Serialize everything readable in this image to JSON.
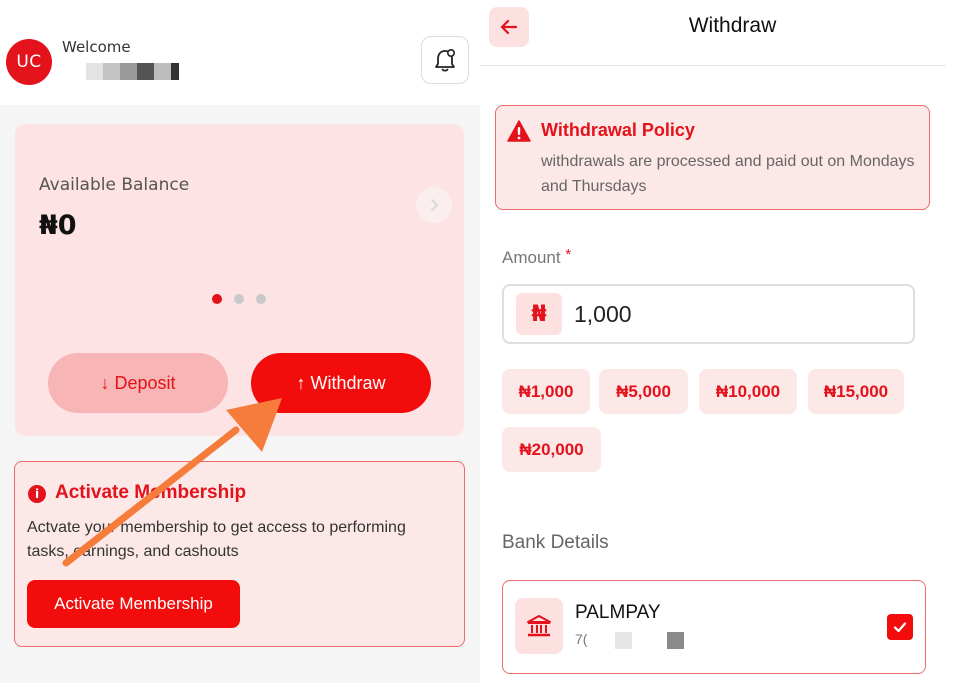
{
  "left": {
    "avatar_initials": "UC",
    "welcome_text": "Welcome",
    "balance_label": "Available Balance",
    "balance_value": "₦0",
    "deposit_label": "↓ Deposit",
    "withdraw_label": "↑ Withdraw",
    "membership": {
      "title": "Activate Membership",
      "description": "Actvate your membership to get access to performing tasks, earnings, and cashouts",
      "button_label": "Activate Membership"
    },
    "icons": [
      "bell-icon",
      "chevron-right-icon",
      "info-icon"
    ],
    "carousel": {
      "total": 3,
      "active": 1
    }
  },
  "right": {
    "title": "Withdraw",
    "policy": {
      "title": "Withdrawal Policy",
      "text": "withdrawals are processed and paid out on Mondays and Thursdays"
    },
    "amount_label": "Amount",
    "required_mark": "*",
    "currency_symbol": "₦",
    "amount_value": "1,000",
    "quick_amounts": [
      "₦1,000",
      "₦5,000",
      "₦10,000",
      "₦15,000",
      "₦20,000"
    ],
    "bank_details_label": "Bank Details",
    "bank": {
      "name": "PALMPAY",
      "account_prefix": "7(",
      "selected": true
    },
    "icons": [
      "back-arrow-icon",
      "warning-icon",
      "bank-icon",
      "checkbox-checked-icon"
    ]
  },
  "colors": {
    "accent": "#f20c0c",
    "accent_light": "#fde8e8",
    "border_accent": "#ef6a6a",
    "annotation_arrow": "#f57c3a"
  }
}
